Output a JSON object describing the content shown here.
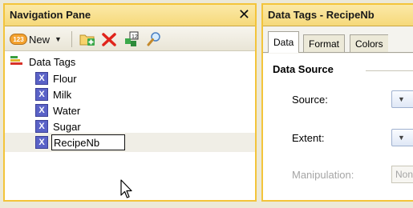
{
  "nav": {
    "title": "Navigation Pane",
    "close_glyph": "✕",
    "toolbar": {
      "new_icon_text": "123",
      "new_label": "New",
      "tools": [
        "new-folder-icon",
        "delete-icon",
        "data-tags-icon",
        "search-icon"
      ]
    },
    "tree": {
      "root_label": "Data Tags",
      "items": [
        {
          "label": "Flour",
          "icon": "X"
        },
        {
          "label": "Milk",
          "icon": "X"
        },
        {
          "label": "Water",
          "icon": "X"
        },
        {
          "label": "Sugar",
          "icon": "X"
        },
        {
          "label": "RecipeNb",
          "icon": "X"
        }
      ],
      "editing_value": "RecipeNb"
    }
  },
  "props": {
    "title": "Data Tags - RecipeNb",
    "tabs": [
      "Data",
      "Format",
      "Colors"
    ],
    "section_title": "Data Source",
    "source_label": "Source:",
    "extent_label": "Extent:",
    "manipulation_label": "Manipulation:",
    "manipulation_value": "None"
  },
  "colors": {
    "pane_border": "#f3c43a",
    "header_bg": "#f6d97a",
    "tag_icon": "#5a62c7"
  }
}
